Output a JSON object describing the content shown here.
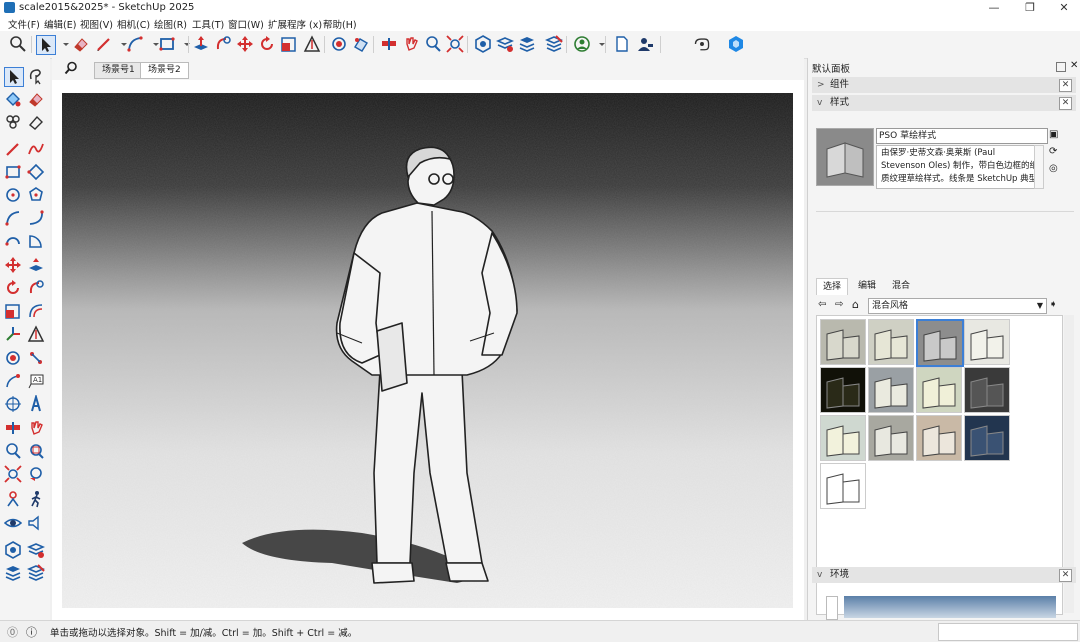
{
  "window": {
    "title": "scale2015&2025* - SketchUp 2025",
    "controls": [
      "—",
      "❐",
      "✕"
    ]
  },
  "menu": [
    "文件(F)",
    "编辑(E)",
    "视图(V)",
    "相机(C)",
    "绘图(R)",
    "工具(T)",
    "窗口(W)",
    "扩展程序 (x)",
    "帮助(H)"
  ],
  "scenes": {
    "tabs": [
      "场景号1",
      "场景号2"
    ],
    "active_index": 1
  },
  "tray": {
    "title": "默认面板",
    "sections": {
      "components": "组件",
      "styles": "样式",
      "environment": "环境"
    },
    "style": {
      "name": "PSO 草绘样式",
      "description": "由保罗·史蒂文森·奥莱斯 (Paul Stevenson Oles) 制作，带白色边框的纸质纹理草绘样式。线条是 SketchUp 典型",
      "tabs": [
        "选择",
        "编辑",
        "混合"
      ],
      "active_tab": 0,
      "library": "混合风格"
    },
    "thumbnails": [
      {
        "bg": "#b9b9ae",
        "fg": "#d8d8cc",
        "dark": false
      },
      {
        "bg": "#cfd0c4",
        "fg": "#e6e6d6",
        "dark": false
      },
      {
        "bg": "#8d8d8d",
        "fg": "#c9c9c9",
        "dark": false,
        "selected": true
      },
      {
        "bg": "#e8e8e2",
        "fg": "#f2f2ea",
        "dark": false
      },
      {
        "bg": "#111108",
        "fg": "#2a2a18",
        "dark": true
      },
      {
        "bg": "#9aa0a4",
        "fg": "#eaeadf",
        "dark": false
      },
      {
        "bg": "#cfd6c0",
        "fg": "#f0f0d8",
        "dark": false
      },
      {
        "bg": "#3a3a3a",
        "fg": "#555555",
        "dark": true
      },
      {
        "bg": "#cfd8d0",
        "fg": "#f2f2dc",
        "dark": false
      },
      {
        "bg": "#a8a8a0",
        "fg": "#e8e8e0",
        "dark": false
      },
      {
        "bg": "#c9b9a6",
        "fg": "#ece6dc",
        "dark": false
      },
      {
        "bg": "#22354f",
        "fg": "#3a5273",
        "dark": true
      },
      {
        "bg": "#ffffff",
        "fg": "#ffffff",
        "dark": false
      }
    ]
  },
  "status": {
    "text": "单击或拖动以选择对象。Shift = 加/减。Ctrl = 加。Shift + Ctrl = 减。",
    "measurements": ""
  }
}
